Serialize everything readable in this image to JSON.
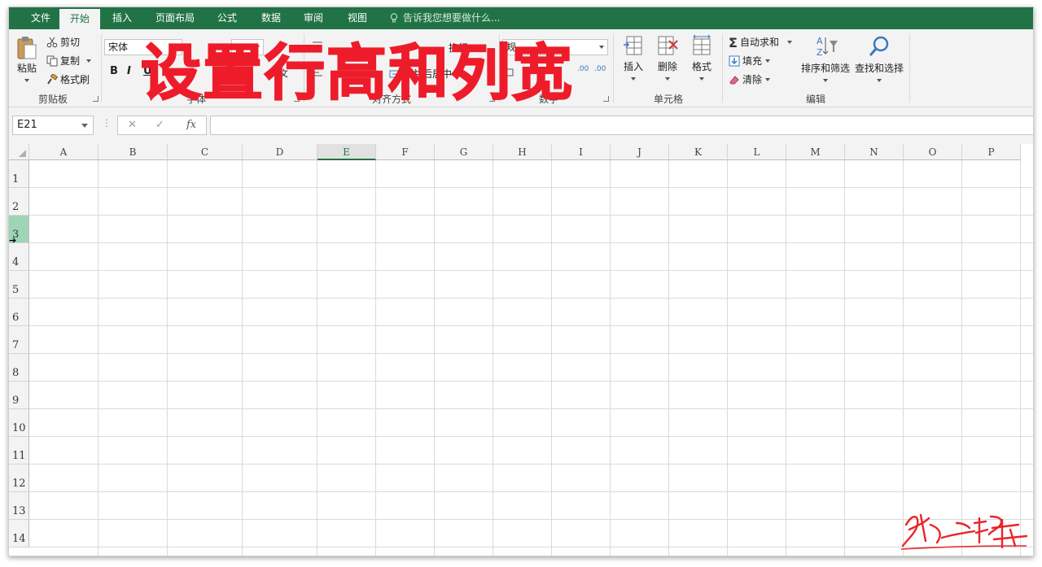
{
  "tabs": [
    {
      "label": "文件",
      "active": false
    },
    {
      "label": "开始",
      "active": true
    },
    {
      "label": "插入",
      "active": false
    },
    {
      "label": "页面布局",
      "active": false
    },
    {
      "label": "公式",
      "active": false
    },
    {
      "label": "数据",
      "active": false
    },
    {
      "label": "审阅",
      "active": false
    },
    {
      "label": "视图",
      "active": false
    }
  ],
  "tell_me": "告诉我您想要做什么...",
  "ribbon": {
    "clipboard": {
      "paste": "粘贴",
      "cut": "剪切",
      "copy": "复制",
      "format_painter": "格式刷",
      "label": "剪贴板"
    },
    "font": {
      "font_name": "宋体",
      "bold": "B",
      "italic": "I",
      "underline": "U",
      "label": "字体",
      "partial_glyph": "文"
    },
    "alignment": {
      "label": "对齐方式",
      "wrap_partial": "换行",
      "merge_partial": "合并后居中"
    },
    "number": {
      "format_partial": "规",
      "label": "数字",
      "inc_decimal": ".00",
      "dec_decimal": ".00"
    },
    "cells": {
      "insert": "插入",
      "delete": "删除",
      "format": "格式",
      "label": "单元格"
    },
    "editing": {
      "autosum": "自动求和",
      "fill": "填充",
      "clear": "清除",
      "sort_filter": "排序和筛选",
      "find_select": "查找和选择",
      "label": "编辑"
    }
  },
  "overlay_title": "设置行高和列宽",
  "formula_bar": {
    "name_box": "E21",
    "cancel": "✕",
    "enter": "✓",
    "fx": "fx",
    "formula": ""
  },
  "columns": [
    "A",
    "B",
    "C",
    "D",
    "E",
    "F",
    "G",
    "H",
    "I",
    "J",
    "K",
    "L",
    "M",
    "N",
    "O",
    "P"
  ],
  "rows": [
    "1",
    "2",
    "3",
    "4",
    "5",
    "6",
    "7",
    "8",
    "9",
    "10",
    "11",
    "12",
    "13",
    "14"
  ],
  "selected_column": "E",
  "hover_row": "3",
  "colors": {
    "brand_green": "#217346",
    "title_red": "#ee1c2a",
    "hover_row": "#9fd5b7"
  }
}
